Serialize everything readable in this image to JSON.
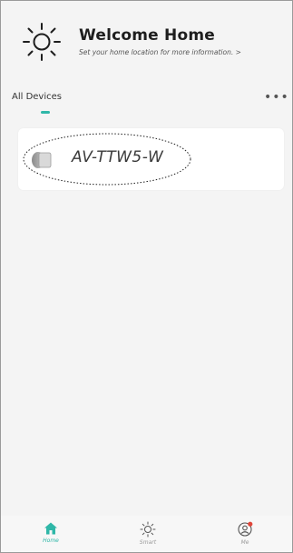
{
  "header": {
    "title": "Welcome Home",
    "subtitle": "Set your home location for more information. >"
  },
  "devices_tab": {
    "label": "All Devices",
    "more_label": "•••"
  },
  "device": {
    "name": "AV-TTW5-W"
  },
  "bottom_nav": {
    "items": [
      {
        "label": "Home",
        "icon": "home-icon",
        "active": true
      },
      {
        "label": "Smart",
        "icon": "sun-icon",
        "active": false
      },
      {
        "label": "Me",
        "icon": "profile-icon",
        "active": false
      }
    ]
  },
  "colors": {
    "accent": "#2fb7a8",
    "notification": "#e0463a",
    "background": "#f4f4f4"
  }
}
